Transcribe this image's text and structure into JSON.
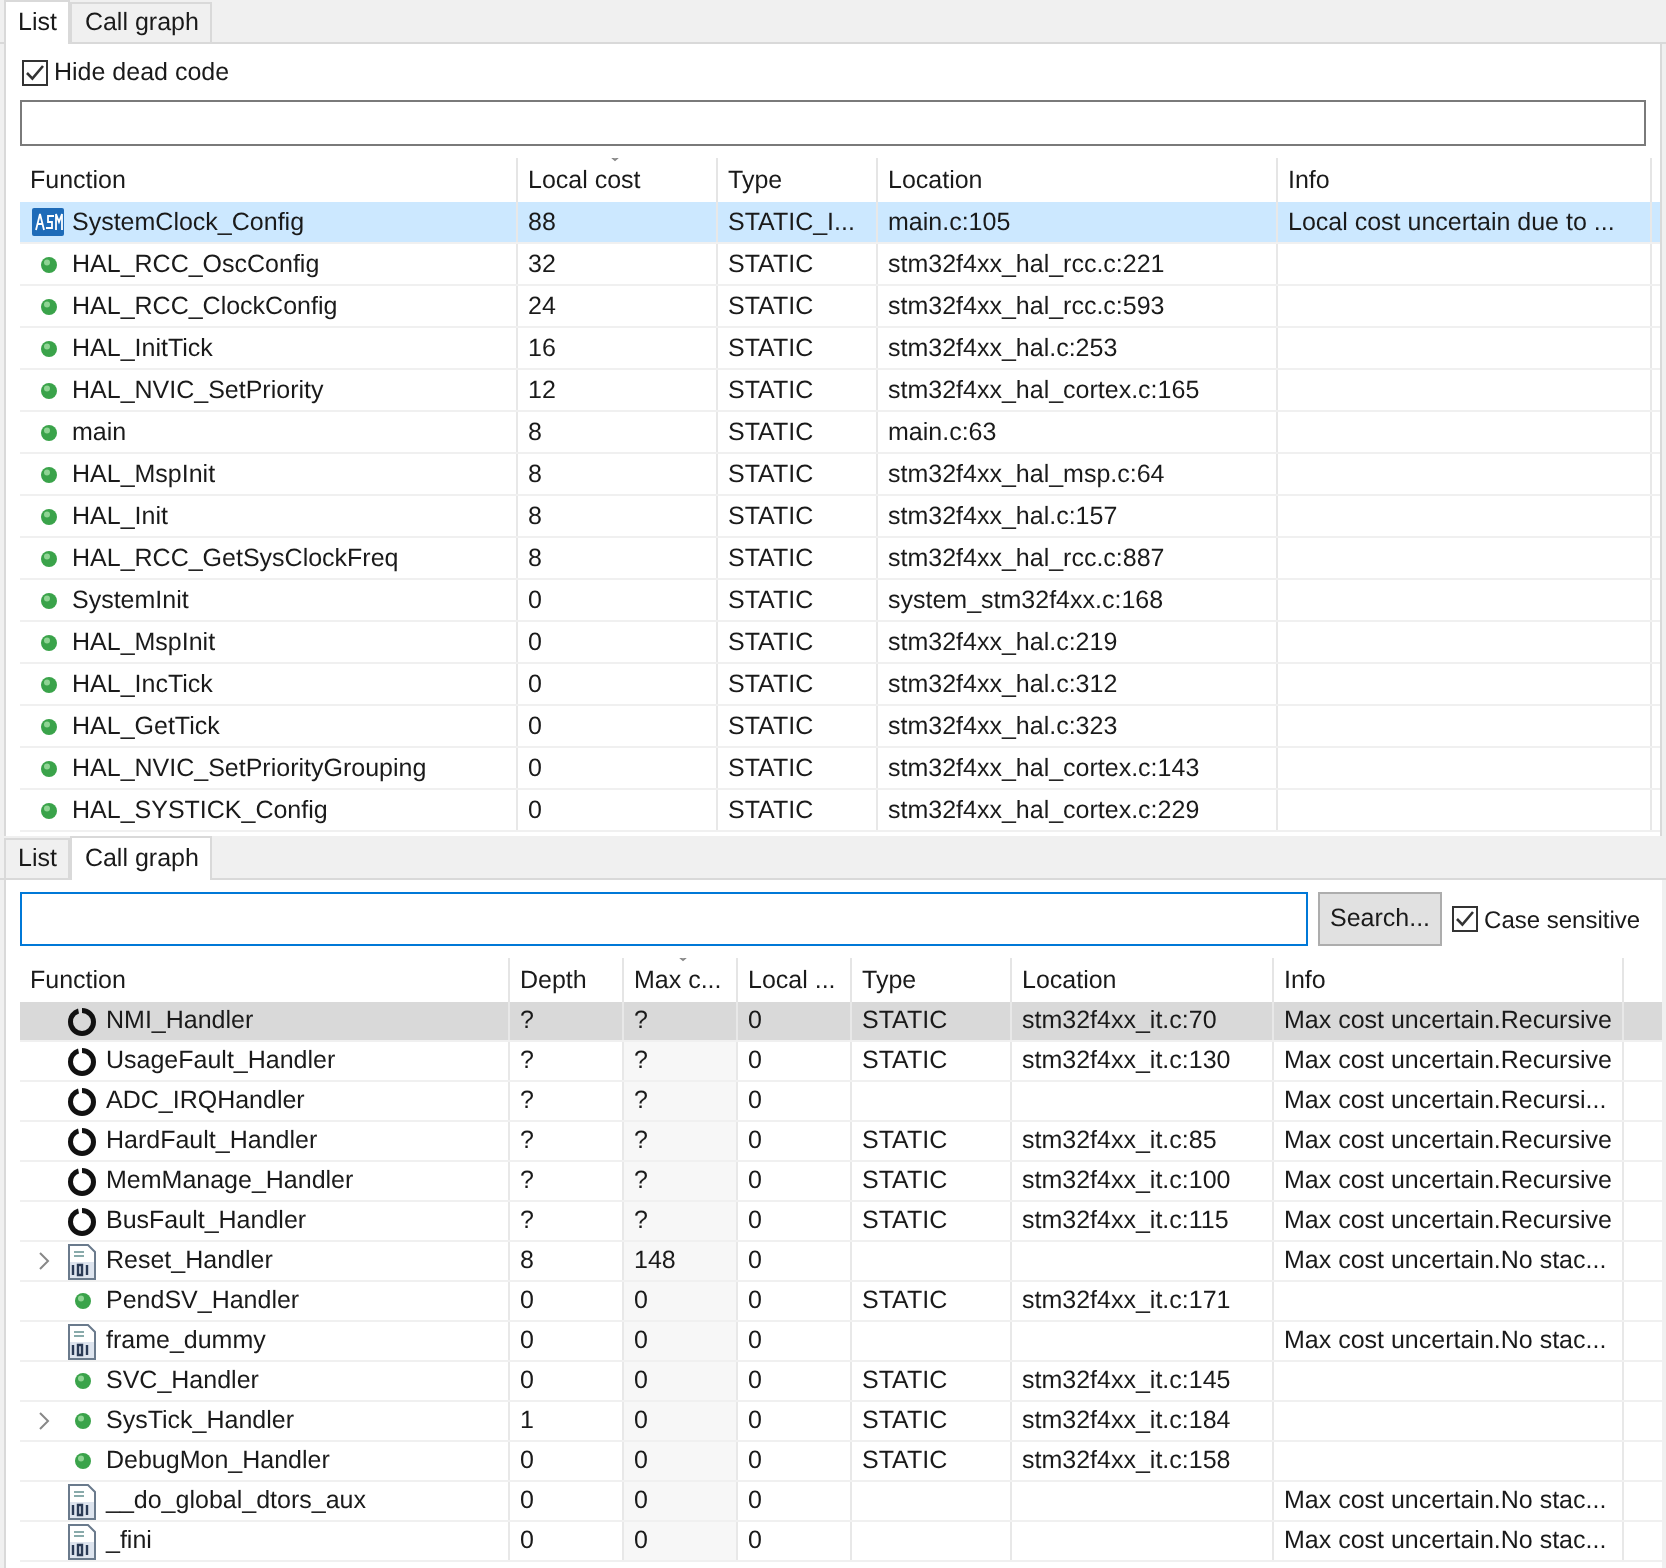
{
  "top_panel": {
    "tabs": [
      {
        "label": "List",
        "selected": true
      },
      {
        "label": "Call graph",
        "selected": false
      }
    ],
    "hide_dead_code": {
      "label": "Hide dead code",
      "checked": true
    },
    "columns": [
      {
        "label": "Function",
        "sorted": false
      },
      {
        "label": "Local cost",
        "sorted": true
      },
      {
        "label": "Type",
        "sorted": false
      },
      {
        "label": "Location",
        "sorted": false
      },
      {
        "label": "Info",
        "sorted": false
      }
    ],
    "rows": [
      {
        "kind": "asm",
        "selected": true,
        "cells": [
          "SystemClock_Config",
          "88",
          "STATIC_I...",
          "main.c:105",
          "Local cost uncertain due to ..."
        ]
      },
      {
        "kind": "dot",
        "selected": false,
        "cells": [
          "HAL_RCC_OscConfig",
          "32",
          "STATIC",
          "stm32f4xx_hal_rcc.c:221",
          ""
        ]
      },
      {
        "kind": "dot",
        "selected": false,
        "cells": [
          "HAL_RCC_ClockConfig",
          "24",
          "STATIC",
          "stm32f4xx_hal_rcc.c:593",
          ""
        ]
      },
      {
        "kind": "dot",
        "selected": false,
        "cells": [
          "HAL_InitTick",
          "16",
          "STATIC",
          "stm32f4xx_hal.c:253",
          ""
        ]
      },
      {
        "kind": "dot",
        "selected": false,
        "cells": [
          "HAL_NVIC_SetPriority",
          "12",
          "STATIC",
          "stm32f4xx_hal_cortex.c:165",
          ""
        ]
      },
      {
        "kind": "dot",
        "selected": false,
        "cells": [
          "main",
          "8",
          "STATIC",
          "main.c:63",
          ""
        ]
      },
      {
        "kind": "dot",
        "selected": false,
        "cells": [
          "HAL_MspInit",
          "8",
          "STATIC",
          "stm32f4xx_hal_msp.c:64",
          ""
        ]
      },
      {
        "kind": "dot",
        "selected": false,
        "cells": [
          "HAL_Init",
          "8",
          "STATIC",
          "stm32f4xx_hal.c:157",
          ""
        ]
      },
      {
        "kind": "dot",
        "selected": false,
        "cells": [
          "HAL_RCC_GetSysClockFreq",
          "8",
          "STATIC",
          "stm32f4xx_hal_rcc.c:887",
          ""
        ]
      },
      {
        "kind": "dot",
        "selected": false,
        "cells": [
          "SystemInit",
          "0",
          "STATIC",
          "system_stm32f4xx.c:168",
          ""
        ]
      },
      {
        "kind": "dot",
        "selected": false,
        "cells": [
          "HAL_MspInit",
          "0",
          "STATIC",
          "stm32f4xx_hal.c:219",
          ""
        ]
      },
      {
        "kind": "dot",
        "selected": false,
        "cells": [
          "HAL_IncTick",
          "0",
          "STATIC",
          "stm32f4xx_hal.c:312",
          ""
        ]
      },
      {
        "kind": "dot",
        "selected": false,
        "cells": [
          "HAL_GetTick",
          "0",
          "STATIC",
          "stm32f4xx_hal.c:323",
          ""
        ]
      },
      {
        "kind": "dot",
        "selected": false,
        "cells": [
          "HAL_NVIC_SetPriorityGrouping",
          "0",
          "STATIC",
          "stm32f4xx_hal_cortex.c:143",
          ""
        ]
      },
      {
        "kind": "dot",
        "selected": false,
        "cells": [
          "HAL_SYSTICK_Config",
          "0",
          "STATIC",
          "stm32f4xx_hal_cortex.c:229",
          ""
        ]
      }
    ]
  },
  "bottom_panel": {
    "tabs": [
      {
        "label": "List",
        "selected": false
      },
      {
        "label": "Call graph",
        "selected": true
      }
    ],
    "search_button": "Search...",
    "case_sensitive": {
      "label": "Case sensitive",
      "checked": true
    },
    "columns": [
      {
        "label": "Function",
        "sorted": false
      },
      {
        "label": "Depth",
        "sorted": false
      },
      {
        "label": "Max c...",
        "sorted": true
      },
      {
        "label": "Local ...",
        "sorted": false
      },
      {
        "label": "Type",
        "sorted": false
      },
      {
        "label": "Location",
        "sorted": false
      },
      {
        "label": "Info",
        "sorted": false
      }
    ],
    "rows": [
      {
        "kind": "recursive",
        "expandable": false,
        "selected": true,
        "cells": [
          "NMI_Handler",
          "?",
          "?",
          "0",
          "STATIC",
          "stm32f4xx_it.c:70",
          "Max cost uncertain.Recursive"
        ]
      },
      {
        "kind": "recursive",
        "expandable": false,
        "selected": false,
        "cells": [
          "UsageFault_Handler",
          "?",
          "?",
          "0",
          "STATIC",
          "stm32f4xx_it.c:130",
          "Max cost uncertain.Recursive"
        ]
      },
      {
        "kind": "recursive",
        "expandable": false,
        "selected": false,
        "cells": [
          "ADC_IRQHandler",
          "?",
          "?",
          "0",
          "",
          "",
          "Max cost uncertain.Recursi..."
        ]
      },
      {
        "kind": "recursive",
        "expandable": false,
        "selected": false,
        "cells": [
          "HardFault_Handler",
          "?",
          "?",
          "0",
          "STATIC",
          "stm32f4xx_it.c:85",
          "Max cost uncertain.Recursive"
        ]
      },
      {
        "kind": "recursive",
        "expandable": false,
        "selected": false,
        "cells": [
          "MemManage_Handler",
          "?",
          "?",
          "0",
          "STATIC",
          "stm32f4xx_it.c:100",
          "Max cost uncertain.Recursive"
        ]
      },
      {
        "kind": "recursive",
        "expandable": false,
        "selected": false,
        "cells": [
          "BusFault_Handler",
          "?",
          "?",
          "0",
          "STATIC",
          "stm32f4xx_it.c:115",
          "Max cost uncertain.Recursive"
        ]
      },
      {
        "kind": "binary",
        "expandable": true,
        "selected": false,
        "cells": [
          "Reset_Handler",
          "8",
          "148",
          "0",
          "",
          "",
          "Max cost uncertain.No stac..."
        ]
      },
      {
        "kind": "dot",
        "expandable": false,
        "selected": false,
        "cells": [
          "PendSV_Handler",
          "0",
          "0",
          "0",
          "STATIC",
          "stm32f4xx_it.c:171",
          ""
        ]
      },
      {
        "kind": "binary",
        "expandable": false,
        "selected": false,
        "cells": [
          "frame_dummy",
          "0",
          "0",
          "0",
          "",
          "",
          "Max cost uncertain.No stac..."
        ]
      },
      {
        "kind": "dot",
        "expandable": false,
        "selected": false,
        "cells": [
          "SVC_Handler",
          "0",
          "0",
          "0",
          "STATIC",
          "stm32f4xx_it.c:145",
          ""
        ]
      },
      {
        "kind": "dot",
        "expandable": true,
        "selected": false,
        "cells": [
          "SysTick_Handler",
          "1",
          "0",
          "0",
          "STATIC",
          "stm32f4xx_it.c:184",
          ""
        ]
      },
      {
        "kind": "dot",
        "expandable": false,
        "selected": false,
        "cells": [
          "DebugMon_Handler",
          "0",
          "0",
          "0",
          "STATIC",
          "stm32f4xx_it.c:158",
          ""
        ]
      },
      {
        "kind": "binary",
        "expandable": false,
        "selected": false,
        "cells": [
          "__do_global_dtors_aux",
          "0",
          "0",
          "0",
          "",
          "",
          "Max cost uncertain.No stac..."
        ]
      },
      {
        "kind": "binary",
        "expandable": false,
        "selected": false,
        "cells": [
          "_fini",
          "0",
          "0",
          "0",
          "",
          "",
          "Max cost uncertain.No stac..."
        ]
      }
    ]
  }
}
